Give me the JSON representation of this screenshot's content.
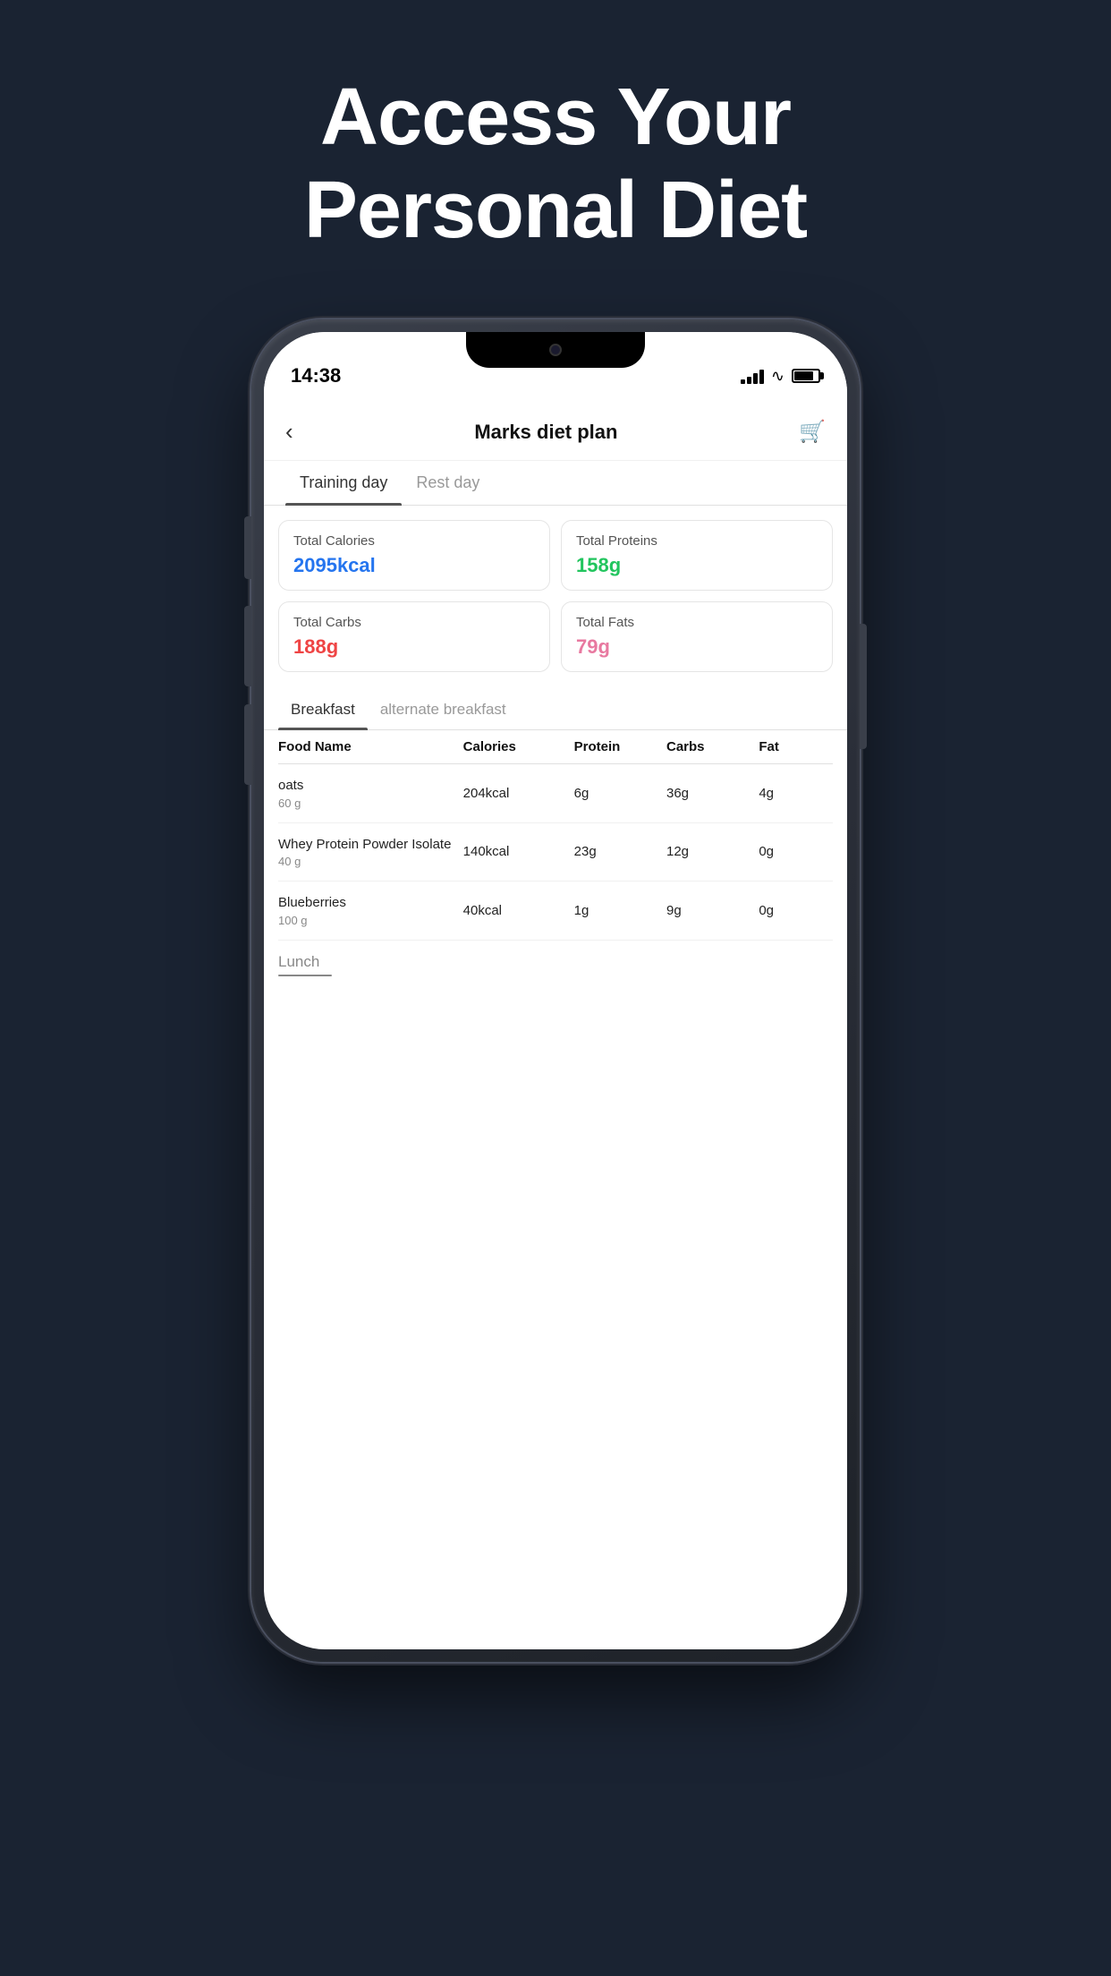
{
  "page": {
    "background": "#1a2332",
    "headline_line1": "Access Your",
    "headline_line2": "Personal Diet"
  },
  "status_bar": {
    "time": "14:38",
    "signal_bars": [
      6,
      9,
      12,
      15
    ],
    "wifi": "wifi",
    "battery": 80
  },
  "header": {
    "back_label": "‹",
    "title": "Marks diet plan",
    "cart_label": "🛒"
  },
  "main_tabs": [
    {
      "label": "Training day",
      "active": true
    },
    {
      "label": "Rest day",
      "active": false
    }
  ],
  "stats": [
    {
      "label": "Total Calories",
      "value": "2095kcal",
      "color_class": "blue"
    },
    {
      "label": "Total Proteins",
      "value": "158g",
      "color_class": "green"
    },
    {
      "label": "Total Carbs",
      "value": "188g",
      "color_class": "red"
    },
    {
      "label": "Total Fats",
      "value": "79g",
      "color_class": "pink"
    }
  ],
  "meal_tabs": [
    {
      "label": "Breakfast",
      "active": true
    },
    {
      "label": "alternate breakfast",
      "active": false
    }
  ],
  "table_headers": [
    "Food Name",
    "Calories",
    "Protein",
    "Carbs",
    "Fat"
  ],
  "food_rows": [
    {
      "name": "oats",
      "amount": "60 g",
      "calories": "204kcal",
      "protein": "6g",
      "carbs": "36g",
      "fat": "4g"
    },
    {
      "name": "Whey Protein Powder Isolate",
      "amount": "40 g",
      "calories": "140kcal",
      "protein": "23g",
      "carbs": "12g",
      "fat": "0g"
    },
    {
      "name": "Blueberries",
      "amount": "100 g",
      "calories": "40kcal",
      "protein": "1g",
      "carbs": "9g",
      "fat": "0g"
    }
  ],
  "next_section": {
    "label": "Lunch"
  }
}
